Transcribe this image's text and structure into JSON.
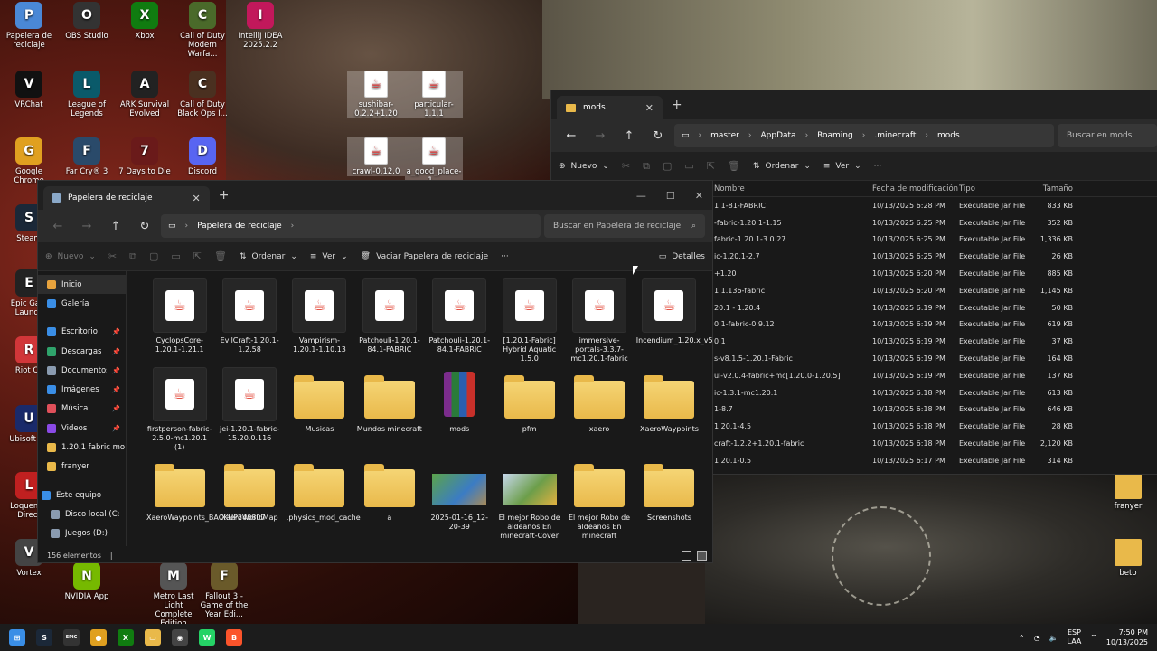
{
  "desktop": {
    "icons": [
      {
        "label": "Papelera de reciclaje",
        "icon": "recycle-bin-icon",
        "color": "#4a88d6"
      },
      {
        "label": "OBS Studio",
        "icon": "obs-icon",
        "color": "#333333"
      },
      {
        "label": "Xbox",
        "icon": "xbox-icon",
        "color": "#107c10"
      },
      {
        "label": "Call of Duty Modern Warfa...",
        "icon": "cod-mw2-icon",
        "color": "#4a6a2a"
      },
      {
        "label": "IntelliJ IDEA 2025.2.2",
        "icon": "intellij-icon",
        "color": "#c2185b"
      },
      {
        "label": "VRChat",
        "icon": "vrchat-icon",
        "color": "#111111"
      },
      {
        "label": "League of Legends",
        "icon": "lol-icon",
        "color": "#0a5a6a"
      },
      {
        "label": "ARK Survival Evolved",
        "icon": "ark-icon",
        "color": "#222222"
      },
      {
        "label": "Call of Duty Black Ops I...",
        "icon": "cod-bo-icon",
        "color": "#4a3020"
      },
      {
        "label": "Google Chrome",
        "icon": "chrome-icon",
        "color": "#e0a020"
      },
      {
        "label": "Far Cry® 3",
        "icon": "farcry-icon",
        "color": "#2a4a6a"
      },
      {
        "label": "7 Days to Die",
        "icon": "7days-icon",
        "color": "#6a1a1a"
      },
      {
        "label": "Discord",
        "icon": "discord-icon",
        "color": "#5865f2"
      },
      {
        "label": "Steam",
        "icon": "steam-icon",
        "color": "#1b2838"
      },
      {
        "label": "Epic Gam Launch",
        "icon": "epic-icon",
        "color": "#222222"
      },
      {
        "label": "Riot Cli",
        "icon": "riot-icon",
        "color": "#d13639"
      },
      {
        "label": "Ubisoft Co",
        "icon": "ubisoft-icon",
        "color": "#1a2a6a"
      },
      {
        "label": "Loquendo Direct",
        "icon": "loquendo-icon",
        "color": "#c02020"
      },
      {
        "label": "Vortex",
        "icon": "vortex-icon",
        "color": "#444444"
      },
      {
        "label": "NVIDIA App",
        "icon": "nvidia-icon",
        "color": "#76b900"
      },
      {
        "label": "Metro Last Light Complete Edition",
        "icon": "metro-icon",
        "color": "#555555"
      },
      {
        "label": "Fallout 3 - Game of the Year Edi...",
        "icon": "fallout-icon",
        "color": "#6a5a2a"
      },
      {
        "label": "sushibar-0.2.2+1.20",
        "icon": "jar-file-icon",
        "color": "#ffffff"
      },
      {
        "label": "particular-1.1.1",
        "icon": "jar-file-icon",
        "color": "#ffffff"
      },
      {
        "label": "crawl-0.12.0",
        "icon": "jar-file-icon",
        "color": "#ffffff"
      },
      {
        "label": "a_good_place-1...",
        "icon": "jar-file-icon",
        "color": "#ffffff"
      },
      {
        "label": "franyer",
        "icon": "folder-icon",
        "color": "#e9b94a"
      },
      {
        "label": "beto",
        "icon": "folder-icon",
        "color": "#e9b94a"
      }
    ]
  },
  "mods_window": {
    "tab_title": "mods",
    "path": [
      "master",
      "AppData",
      "Roaming",
      ".minecraft",
      "mods"
    ],
    "search_placeholder": "Buscar en mods",
    "toolbar": {
      "new": "Nuevo",
      "sort": "Ordenar",
      "view": "Ver",
      "more": "···"
    },
    "columns": {
      "name": "Nombre",
      "date": "Fecha de modificación",
      "type": "Tipo",
      "size": "Tamaño"
    },
    "rows": [
      {
        "name": "1.1-81-FABRIC",
        "date": "10/13/2025 6:28 PM",
        "type": "Executable Jar File",
        "size": "833 KB"
      },
      {
        "name": "-fabric-1.20.1-1.15",
        "date": "10/13/2025 6:25 PM",
        "type": "Executable Jar File",
        "size": "352 KB"
      },
      {
        "name": "fabric-1.20.1-3.0.27",
        "date": "10/13/2025 6:25 PM",
        "type": "Executable Jar File",
        "size": "1,336 KB"
      },
      {
        "name": "ic-1.20.1-2.7",
        "date": "10/13/2025 6:25 PM",
        "type": "Executable Jar File",
        "size": "26 KB"
      },
      {
        "name": "+1.20",
        "date": "10/13/2025 6:20 PM",
        "type": "Executable Jar File",
        "size": "885 KB"
      },
      {
        "name": "1.1.136-fabric",
        "date": "10/13/2025 6:20 PM",
        "type": "Executable Jar File",
        "size": "1,145 KB"
      },
      {
        "name": "20.1 - 1.20.4",
        "date": "10/13/2025 6:19 PM",
        "type": "Executable Jar File",
        "size": "50 KB"
      },
      {
        "name": "0.1-fabric-0.9.12",
        "date": "10/13/2025 6:19 PM",
        "type": "Executable Jar File",
        "size": "619 KB"
      },
      {
        "name": "0.1",
        "date": "10/13/2025 6:19 PM",
        "type": "Executable Jar File",
        "size": "37 KB"
      },
      {
        "name": "s-v8.1.5-1.20.1-Fabric",
        "date": "10/13/2025 6:19 PM",
        "type": "Executable Jar File",
        "size": "164 KB"
      },
      {
        "name": "ul-v2.0.4-fabric+mc[1.20.0-1.20.5]",
        "date": "10/13/2025 6:19 PM",
        "type": "Executable Jar File",
        "size": "137 KB"
      },
      {
        "name": "ic-1.3.1-mc1.20.1",
        "date": "10/13/2025 6:18 PM",
        "type": "Executable Jar File",
        "size": "613 KB"
      },
      {
        "name": "1-8.7",
        "date": "10/13/2025 6:18 PM",
        "type": "Executable Jar File",
        "size": "646 KB"
      },
      {
        "name": "1.20.1-4.5",
        "date": "10/13/2025 6:18 PM",
        "type": "Executable Jar File",
        "size": "28 KB"
      },
      {
        "name": "craft-1.2.2+1.20.1-fabric",
        "date": "10/13/2025 6:18 PM",
        "type": "Executable Jar File",
        "size": "2,120 KB"
      },
      {
        "name": "1.20.1-0.5",
        "date": "10/13/2025 6:17 PM",
        "type": "Executable Jar File",
        "size": "314 KB"
      }
    ]
  },
  "bin_window": {
    "tab_title": "Papelera de reciclaje",
    "path": "Papelera de reciclaje",
    "search_placeholder": "Buscar en Papelera de reciclaje",
    "toolbar": {
      "new": "Nuevo",
      "sort": "Ordenar",
      "view": "Ver",
      "empty": "Vaciar Papelera de reciclaje",
      "more": "···",
      "details": "Detalles"
    },
    "sidebar": [
      {
        "label": "Inicio",
        "icon": "home-icon",
        "color": "#e8a33d",
        "pin": false
      },
      {
        "label": "Galería",
        "icon": "gallery-icon",
        "color": "#3a8ee6",
        "pin": false
      },
      {
        "label": "Escritorio",
        "icon": "desktop-icon",
        "color": "#3a8ee6",
        "pin": true
      },
      {
        "label": "Descargas",
        "icon": "downloads-icon",
        "color": "#2fa36b",
        "pin": true
      },
      {
        "label": "Documentos",
        "icon": "documents-icon",
        "color": "#8a9bb0",
        "pin": true
      },
      {
        "label": "Imágenes",
        "icon": "pictures-icon",
        "color": "#3a8ee6",
        "pin": true
      },
      {
        "label": "Música",
        "icon": "music-icon",
        "color": "#e0505a",
        "pin": true
      },
      {
        "label": "Videos",
        "icon": "videos-icon",
        "color": "#8a4ae6",
        "pin": true
      },
      {
        "label": "1.20.1 fabric mo",
        "icon": "folder-icon",
        "color": "#e9b94a",
        "pin": false
      },
      {
        "label": "franyer",
        "icon": "folder-icon",
        "color": "#e9b94a",
        "pin": false
      },
      {
        "label": "Este equipo",
        "icon": "pc-icon",
        "color": "#3a8ee6",
        "pin": false
      },
      {
        "label": "Disco local (C:",
        "icon": "drive-icon",
        "color": "#8a9bb0",
        "pin": false
      },
      {
        "label": "Juegos (D:)",
        "icon": "drive-icon",
        "color": "#8a9bb0",
        "pin": false
      }
    ],
    "items": [
      {
        "label": "CyclopsCore-1.20.1-1.21.1",
        "kind": "jar"
      },
      {
        "label": "EvilCraft-1.20.1-1.2.58",
        "kind": "jar"
      },
      {
        "label": "Vampirism-1.20.1-1.10.13",
        "kind": "jar"
      },
      {
        "label": "Patchouli-1.20.1-84.1-FABRIC",
        "kind": "jar"
      },
      {
        "label": "Patchouli-1.20.1-84.1-FABRIC",
        "kind": "jar"
      },
      {
        "label": "[1.20.1-Fabric] Hybrid Aquatic 1.5.0",
        "kind": "jar"
      },
      {
        "label": "immersive-portals-3.3.7-mc1.20.1-fabric",
        "kind": "jar"
      },
      {
        "label": "Incendium_1.20.x_v5.3.5",
        "kind": "jar"
      },
      {
        "label": "firstperson-fabric-2.5.0-mc1.20.1 (1)",
        "kind": "jar"
      },
      {
        "label": "jei-1.20.1-fabric-15.20.0.116",
        "kind": "jar"
      },
      {
        "label": "Musicas",
        "kind": "folder"
      },
      {
        "label": "Mundos minecraft",
        "kind": "folder"
      },
      {
        "label": "mods",
        "kind": "winrar"
      },
      {
        "label": "pfm",
        "kind": "folder"
      },
      {
        "label": "xaero",
        "kind": "folder"
      },
      {
        "label": "XaeroWaypoints",
        "kind": "folder"
      },
      {
        "label": "XaeroWaypoints_BACKUP240807",
        "kind": "folder"
      },
      {
        "label": "XaeroWorldMap",
        "kind": "folder"
      },
      {
        "label": ".physics_mod_cache",
        "kind": "folder"
      },
      {
        "label": "a",
        "kind": "folder"
      },
      {
        "label": "2025-01-16_12-20-39",
        "kind": "image"
      },
      {
        "label": "El mejor Robo de aldeanos En minecraft-Cover",
        "kind": "image2"
      },
      {
        "label": "El mejor Robo de aldeanos En minecraft",
        "kind": "folder"
      },
      {
        "label": "Screenshots",
        "kind": "folder"
      }
    ],
    "status": "156 elementos"
  },
  "taskbar": {
    "apps": [
      {
        "icon": "start-icon",
        "color": "#3a8ee6",
        "glyph": "⊞"
      },
      {
        "icon": "steam-icon",
        "color": "#1b2838",
        "glyph": "S"
      },
      {
        "icon": "epic-icon",
        "color": "#333333",
        "glyph": "EPIC"
      },
      {
        "icon": "chrome-icon",
        "color": "#e0a020",
        "glyph": "●"
      },
      {
        "icon": "xbox-icon",
        "color": "#107c10",
        "glyph": "X"
      },
      {
        "icon": "file-explorer-icon",
        "color": "#e9b94a",
        "glyph": "▭"
      },
      {
        "icon": "obs-icon",
        "color": "#444444",
        "glyph": "◉"
      },
      {
        "icon": "whatsapp-icon",
        "color": "#25d366",
        "glyph": "W"
      },
      {
        "icon": "brave-icon",
        "color": "#fb542b",
        "glyph": "B"
      }
    ],
    "lang": "ESP",
    "lang_sub": "LAA",
    "time": "7:50 PM",
    "date": "10/13/2025"
  }
}
